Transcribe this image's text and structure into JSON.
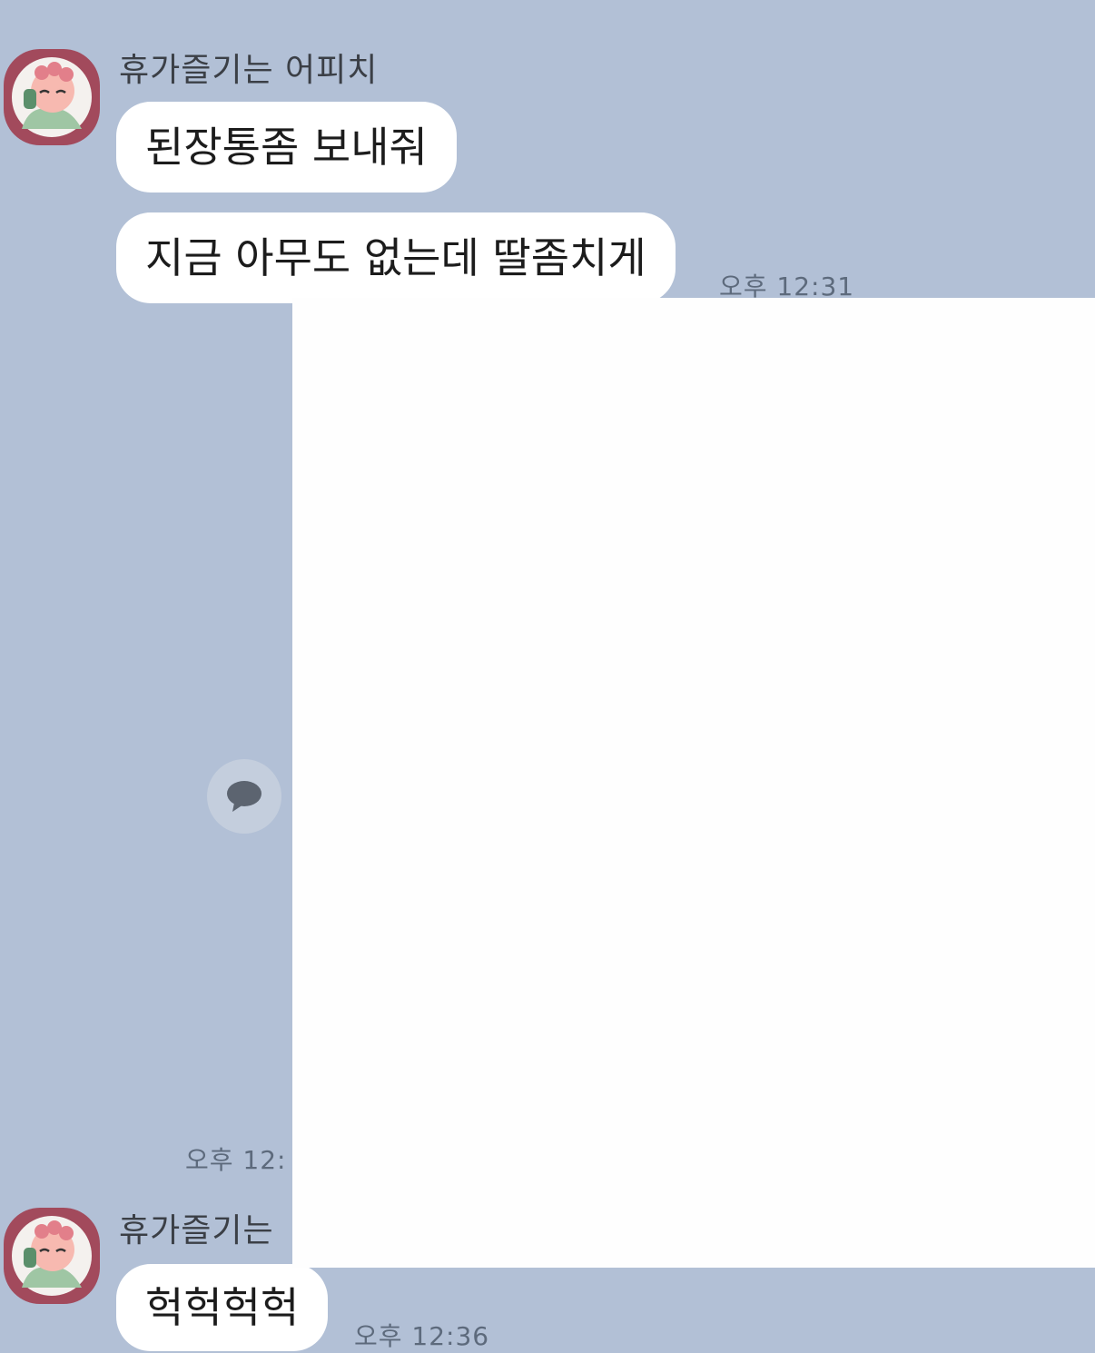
{
  "messages": [
    {
      "sender": "휴가즐기는 어피치",
      "bubbles": [
        "된장통좀 보내줘",
        "지금 아무도 없는데 딸좀치게"
      ],
      "time": "오후 12:31"
    },
    {
      "sender": "휴가즐기는",
      "bubbles": [
        "헉헉헉헉"
      ],
      "time": "오후 12:36"
    }
  ],
  "partial_time": "오후 12:",
  "icons": {
    "avatar": "apeach-avatar-icon",
    "reply": "speech-bubble-icon"
  },
  "colors": {
    "background": "#b2c0d6",
    "bubble": "#ffffff",
    "avatar_frame": "#a24a5c"
  }
}
